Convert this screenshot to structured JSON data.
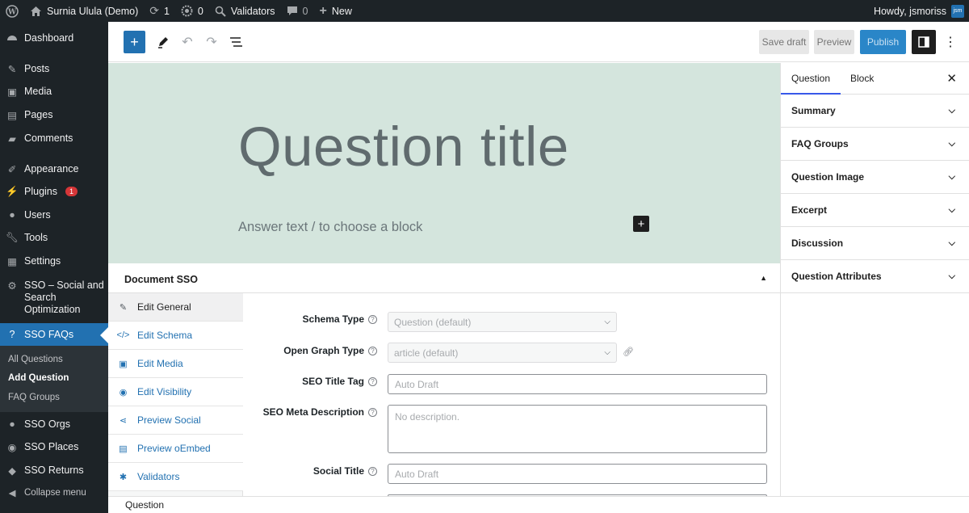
{
  "adminbar": {
    "site_name": "Surnia Ulula (Demo)",
    "updates_count": "1",
    "comments_count": "0",
    "sso_count": "0",
    "validators": "Validators",
    "new": "New",
    "howdy": "Howdy, jsmoriss",
    "avatar_text": "jsm"
  },
  "sidebar": {
    "items": [
      {
        "label": "Dashboard",
        "icon": "dashboard-icon"
      },
      {
        "label": "Posts",
        "icon": "pin-icon"
      },
      {
        "label": "Media",
        "icon": "media-icon"
      },
      {
        "label": "Pages",
        "icon": "pages-icon"
      },
      {
        "label": "Comments",
        "icon": "comment-icon"
      },
      {
        "label": "Appearance",
        "icon": "brush-icon"
      },
      {
        "label": "Plugins",
        "icon": "plugin-icon",
        "badge": "1"
      },
      {
        "label": "Users",
        "icon": "user-icon"
      },
      {
        "label": "Tools",
        "icon": "wrench-icon"
      },
      {
        "label": "Settings",
        "icon": "settings-icon"
      },
      {
        "label": "SSO – Social and Search Optimization",
        "icon": "sso-icon"
      },
      {
        "label": "SSO FAQs",
        "icon": "question-icon"
      },
      {
        "label": "SSO Orgs",
        "icon": "groups-icon"
      },
      {
        "label": "SSO Places",
        "icon": "location-icon"
      },
      {
        "label": "SSO Returns",
        "icon": "tag-icon"
      },
      {
        "label": "Collapse menu",
        "icon": "collapse-icon"
      }
    ],
    "sso_label_lines": [
      "SSO – Social and",
      "Search",
      "Optimization"
    ],
    "submenu": [
      "All Questions",
      "Add Question",
      "FAQ Groups"
    ]
  },
  "toolbar": {
    "save_draft": "Save draft",
    "preview": "Preview",
    "publish": "Publish"
  },
  "editor": {
    "title_placeholder": "Question title",
    "answer_placeholder": "Answer text / to choose a block"
  },
  "metabox": {
    "title": "Document SSO",
    "tabs": [
      {
        "label": "Edit General",
        "icon": "edit-icon"
      },
      {
        "label": "Edit Schema",
        "icon": "code-icon"
      },
      {
        "label": "Edit Media",
        "icon": "image-icon"
      },
      {
        "label": "Edit Visibility",
        "icon": "eye-icon"
      },
      {
        "label": "Preview Social",
        "icon": "share-icon"
      },
      {
        "label": "Preview oEmbed",
        "icon": "embed-icon"
      },
      {
        "label": "Validators",
        "icon": "bug-icon"
      }
    ],
    "fields": {
      "schema_type_label": "Schema Type",
      "schema_type_value": "Question (default)",
      "og_type_label": "Open Graph Type",
      "og_type_value": "article (default)",
      "seo_title_label": "SEO Title Tag",
      "seo_title_placeholder": "Auto Draft",
      "seo_desc_label": "SEO Meta Description",
      "seo_desc_placeholder": "No description.",
      "social_title_label": "Social Title",
      "social_title_placeholder": "Auto Draft"
    }
  },
  "footer": {
    "breadcrumb": "Question"
  },
  "panel": {
    "tab_question": "Question",
    "tab_block": "Block",
    "sections": [
      "Summary",
      "FAQ Groups",
      "Question Image",
      "Excerpt",
      "Discussion",
      "Question Attributes"
    ]
  },
  "colors": {
    "admin_dark": "#1d2327",
    "accent": "#2271b1",
    "canvas_bg": "#d4e5dd",
    "badge": "#d63638"
  }
}
